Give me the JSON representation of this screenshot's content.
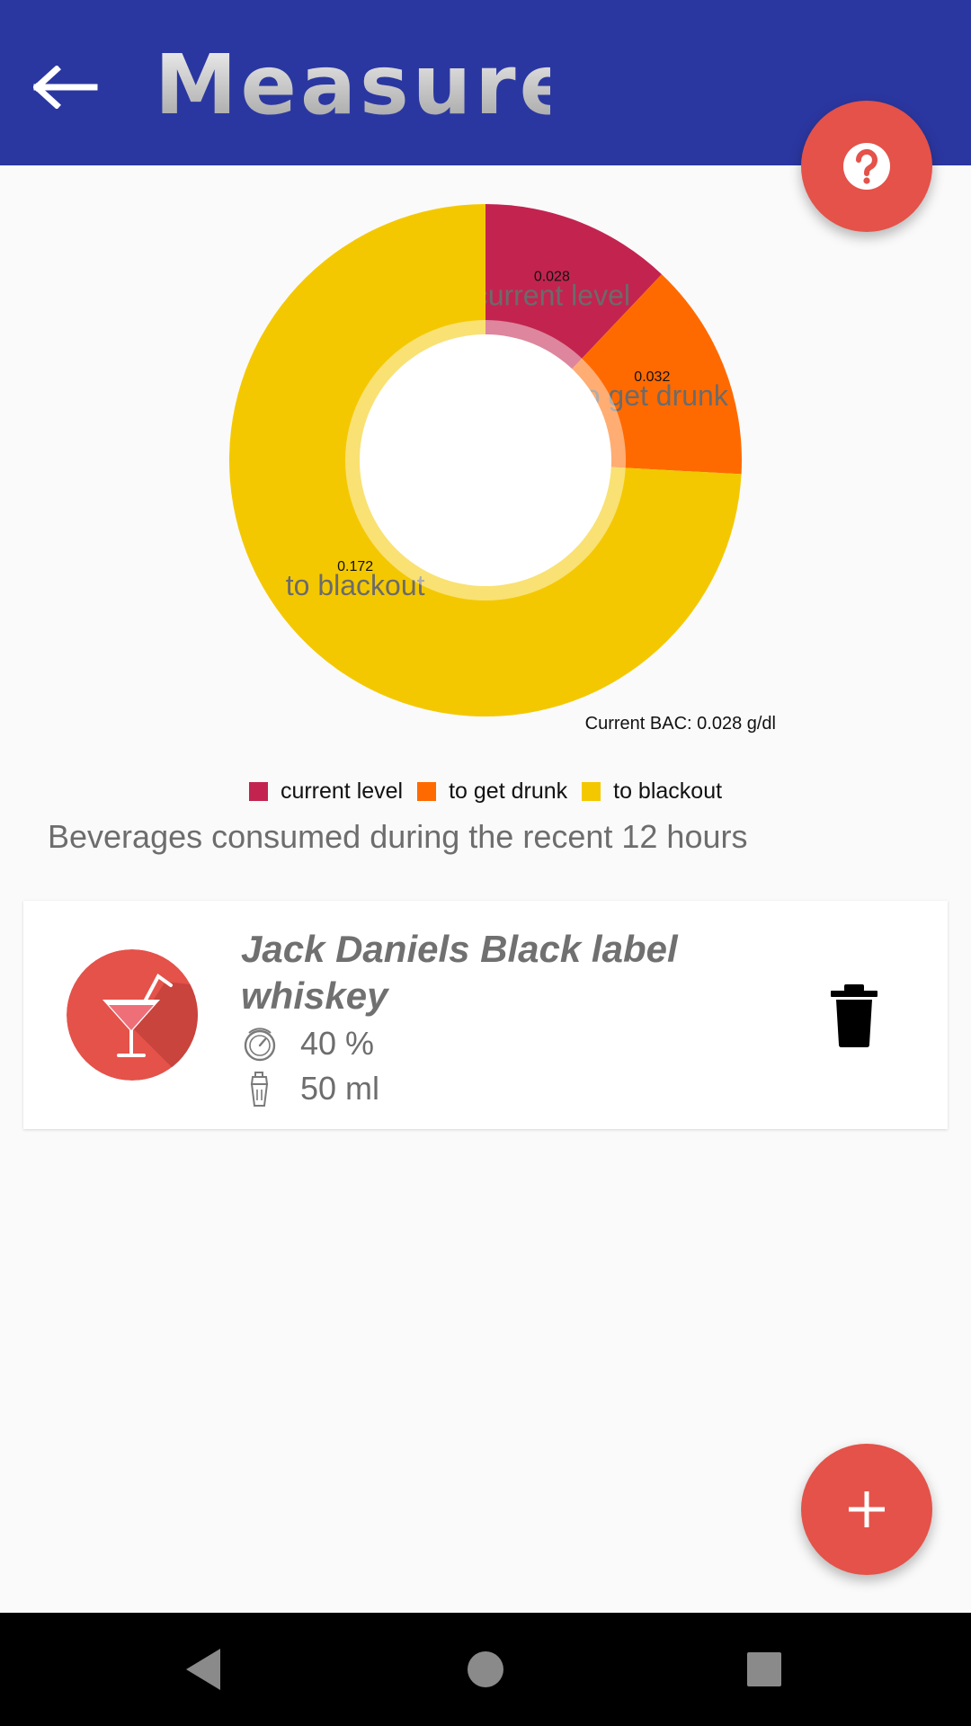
{
  "appbar": {
    "title": "Measure",
    "back_icon": "arrow-left-icon",
    "help_icon": "question-circle-icon",
    "color": "#2b37a0"
  },
  "chart_data": {
    "type": "pie",
    "style": "donut",
    "categories": [
      "current level",
      "to get drunk",
      "to blackout"
    ],
    "values": [
      0.028,
      0.032,
      0.172
    ],
    "value_labels": [
      "0.028",
      "0.032",
      "0.172"
    ],
    "colors": [
      "#c2244f",
      "#ff6a00",
      "#f4c800"
    ],
    "description": "Current BAC: 0.028 g/dl",
    "legend": "bottom-center"
  },
  "section": {
    "title": "Beverages consumed during the recent 12 hours"
  },
  "beverages": [
    {
      "name": "Jack Daniels Black label whiskey",
      "strength": "40 %",
      "volume": "50 ml",
      "icon": "cocktail-glass-icon",
      "strength_icon": "gauge-icon",
      "volume_icon": "shaker-icon",
      "delete_icon": "trash-icon"
    }
  ],
  "fab": {
    "add_icon": "plus-icon",
    "color": "#e4524a"
  },
  "navbar": {
    "back_icon": "nav-back-icon",
    "home_icon": "nav-home-icon",
    "recents_icon": "nav-recents-icon"
  }
}
